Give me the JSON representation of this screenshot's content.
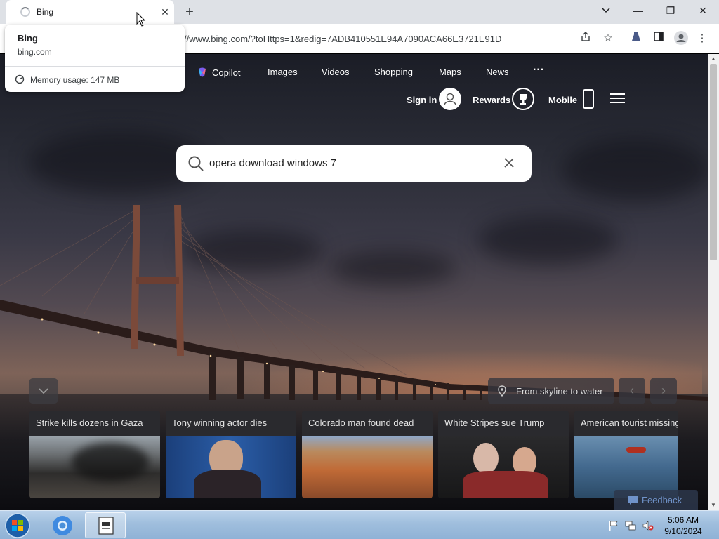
{
  "browser": {
    "tab_title": "Bing",
    "url": "//www.bing.com/?toHttps=1&redig=7ADB410551E94A7090ACA66E3721E91D",
    "hover_card": {
      "title": "Bing",
      "domain": "bing.com",
      "memory": "Memory usage: 147 MB"
    }
  },
  "bing": {
    "nav": {
      "copilot": "Copilot",
      "images": "Images",
      "videos": "Videos",
      "shopping": "Shopping",
      "maps": "Maps",
      "news": "News",
      "more": "···"
    },
    "header": {
      "sign_in": "Sign in",
      "rewards": "Rewards",
      "mobile": "Mobile"
    },
    "search": {
      "query": "opera download windows 7"
    },
    "image_caption": "From skyline to water",
    "news_cards": [
      {
        "title": "Strike kills dozens in Gaza"
      },
      {
        "title": "Tony winning actor dies"
      },
      {
        "title": "Colorado man found dead"
      },
      {
        "title": "White Stripes sue Trump"
      },
      {
        "title": "American tourist missing"
      }
    ],
    "feedback": "Feedback"
  },
  "taskbar": {
    "time": "5:06 AM",
    "date": "9/10/2024"
  },
  "colors": {
    "tabstrip": "#dee1e6",
    "bing_accent": "#6f92c9",
    "taskbar": "#9fbedd"
  }
}
